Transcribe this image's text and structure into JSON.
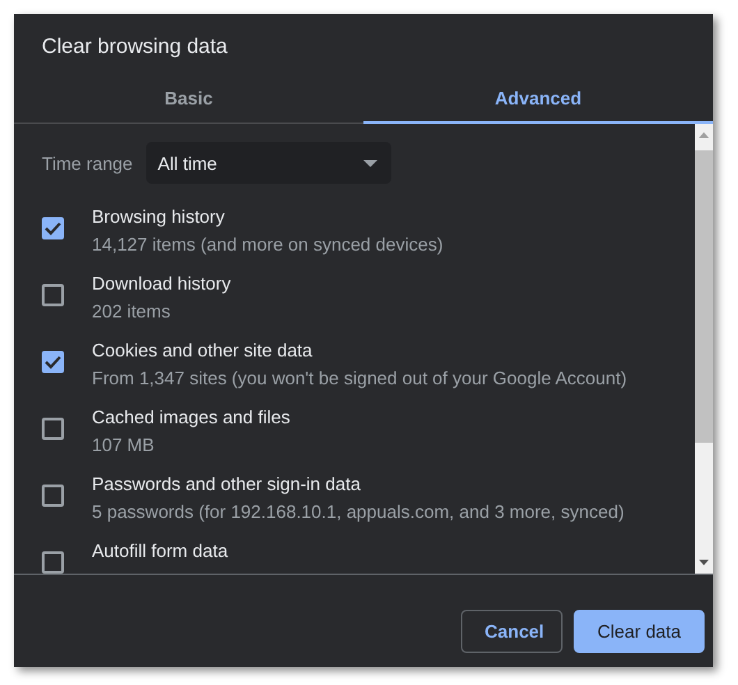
{
  "dialog": {
    "title": "Clear browsing data"
  },
  "tabs": [
    {
      "label": "Basic",
      "selected": false
    },
    {
      "label": "Advanced",
      "selected": true
    }
  ],
  "time_range": {
    "label": "Time range",
    "value": "All time"
  },
  "items": [
    {
      "title": "Browsing history",
      "detail": "14,127 items (and more on synced devices)",
      "checked": true
    },
    {
      "title": "Download history",
      "detail": "202 items",
      "checked": false
    },
    {
      "title": "Cookies and other site data",
      "detail": "From 1,347 sites (you won't be signed out of your Google Account)",
      "checked": true
    },
    {
      "title": "Cached images and files",
      "detail": "107 MB",
      "checked": false
    },
    {
      "title": "Passwords and other sign-in data",
      "detail": "5 passwords (for 192.168.10.1, appuals.com, and 3 more, synced)",
      "checked": false
    },
    {
      "title": "Autofill form data",
      "checked": false
    }
  ],
  "buttons": [
    {
      "label": "Cancel",
      "kind": "secondary"
    },
    {
      "label": "Clear data",
      "kind": "primary"
    }
  ]
}
